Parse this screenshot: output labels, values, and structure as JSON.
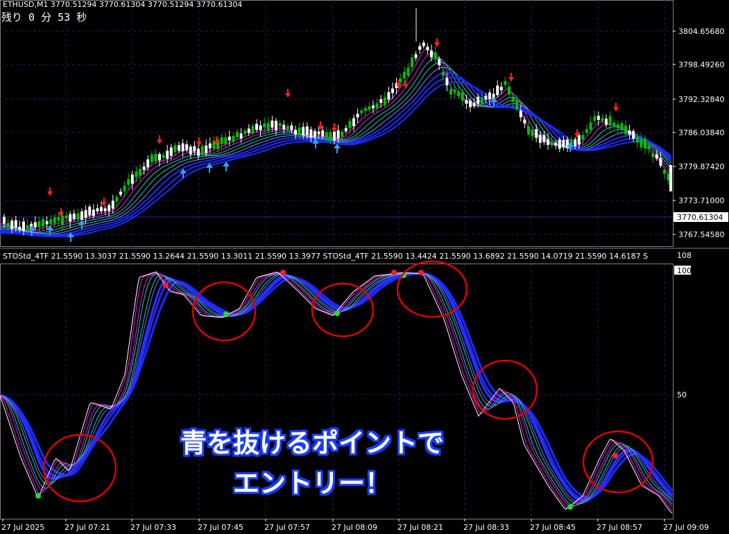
{
  "header": {
    "symbol_line": "ETHUSD,M1  3770.51294 3770.61304 3770.51294 3770.61304"
  },
  "timer": {
    "text": "残り 0 分 53 秒"
  },
  "price_axis": {
    "labels": [
      "3804.65680",
      "3798.49260",
      "3792.32840",
      "3786.03840",
      "3779.87420",
      "3773.71000",
      "3767.54580"
    ],
    "current_price": "3770.61304"
  },
  "indicator": {
    "header": "STOStd_4TF 21.5590 13.3037 21.5590 13.2644 21.5590 13.3011 21.5590 13.3977  STOStd_4TF 21.5590 13.4424 21.5590 13.6892 21.5590 14.0719 21.5590 14.6187  S",
    "axis_labels": [
      "108",
      "100",
      "50"
    ]
  },
  "time_axis": {
    "labels": [
      "27 Jul 2025",
      "27 Jul 07:21",
      "27 Jul 07:33",
      "27 Jul 07:45",
      "27 Jul 07:57",
      "27 Jul 08:09",
      "27 Jul 08:21",
      "27 Jul 08:33",
      "27 Jul 08:45",
      "27 Jul 08:57",
      "27 Jul 09:09"
    ]
  },
  "annotation": {
    "line1": "青を抜けるポイントで",
    "line2": "エントリー！"
  },
  "colors": {
    "bull": "#00c000",
    "bear": "#ffffff",
    "ma_blue": "#1a2cff",
    "ma_magenta": "#e020e0",
    "ma_cyan": "#20c8c8",
    "circle": "#e00000",
    "grid": "#1c1c6a"
  }
}
